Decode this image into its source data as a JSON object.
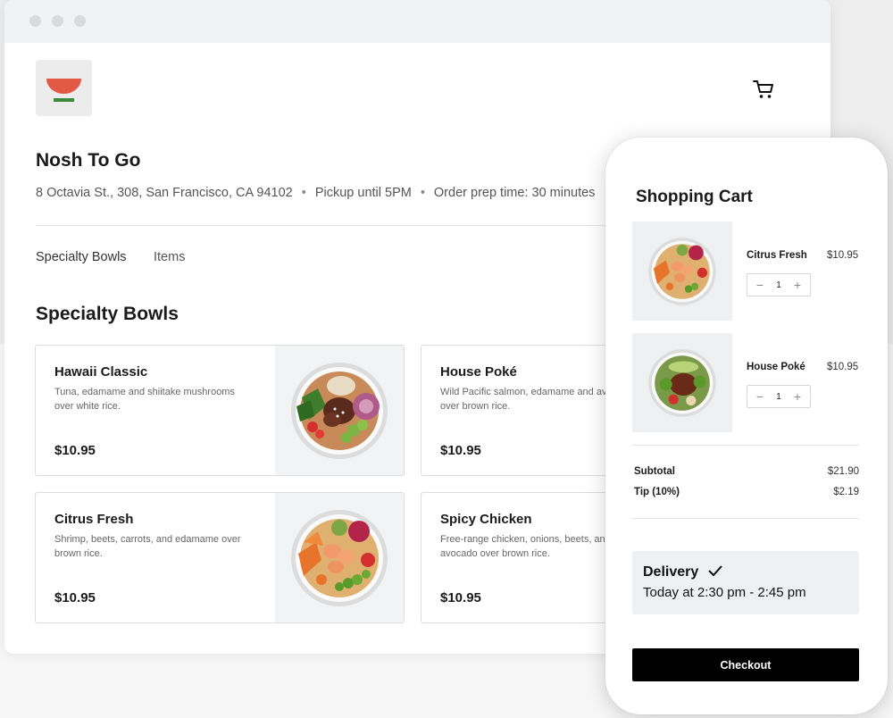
{
  "store": {
    "name": "Nosh To Go",
    "address": "8 Octavia St., 308, San Francisco, CA 94102",
    "pickup": "Pickup until 5PM",
    "prep_time": "Order prep time: 30 minutes"
  },
  "header": {
    "logo_icon": "bowl-icon",
    "cart_icon": "cart-icon"
  },
  "tabs": [
    {
      "label": "Specialty Bowls",
      "active": true
    },
    {
      "label": "Items",
      "active": false
    }
  ],
  "section": {
    "title": "Specialty Bowls"
  },
  "menu_items": [
    {
      "title": "Hawaii Classic",
      "desc": "Tuna, edamame and shiitake mushrooms over white rice.",
      "price": "$10.95"
    },
    {
      "title": "House Poké",
      "desc": "Wild Pacific salmon, edamame and avocado over brown rice.",
      "price": "$10.95"
    },
    {
      "title": "Citrus Fresh",
      "desc": "Shrimp, beets, carrots, and edamame over brown rice.",
      "price": "$10.95"
    },
    {
      "title": "Spicy Chicken",
      "desc": "Free-range chicken, onions, beets, and avocado over brown rice.",
      "price": "$10.95"
    }
  ],
  "cart": {
    "title": "Shopping Cart",
    "items": [
      {
        "name": "Citrus Fresh",
        "price": "$10.95",
        "qty": "1"
      },
      {
        "name": "House Poké",
        "price": "$10.95",
        "qty": "1"
      }
    ],
    "subtotal_label": "Subtotal",
    "subtotal": "$21.90",
    "tip_label": "Tip (10%)",
    "tip": "$2.19",
    "delivery_label": "Delivery",
    "delivery_time": "Today at 2:30 pm - 2:45 pm",
    "checkout_label": "Checkout"
  },
  "colors": {
    "accent": "#e25a43",
    "logo_green": "#3a8a3a",
    "checkout": "#000000"
  }
}
